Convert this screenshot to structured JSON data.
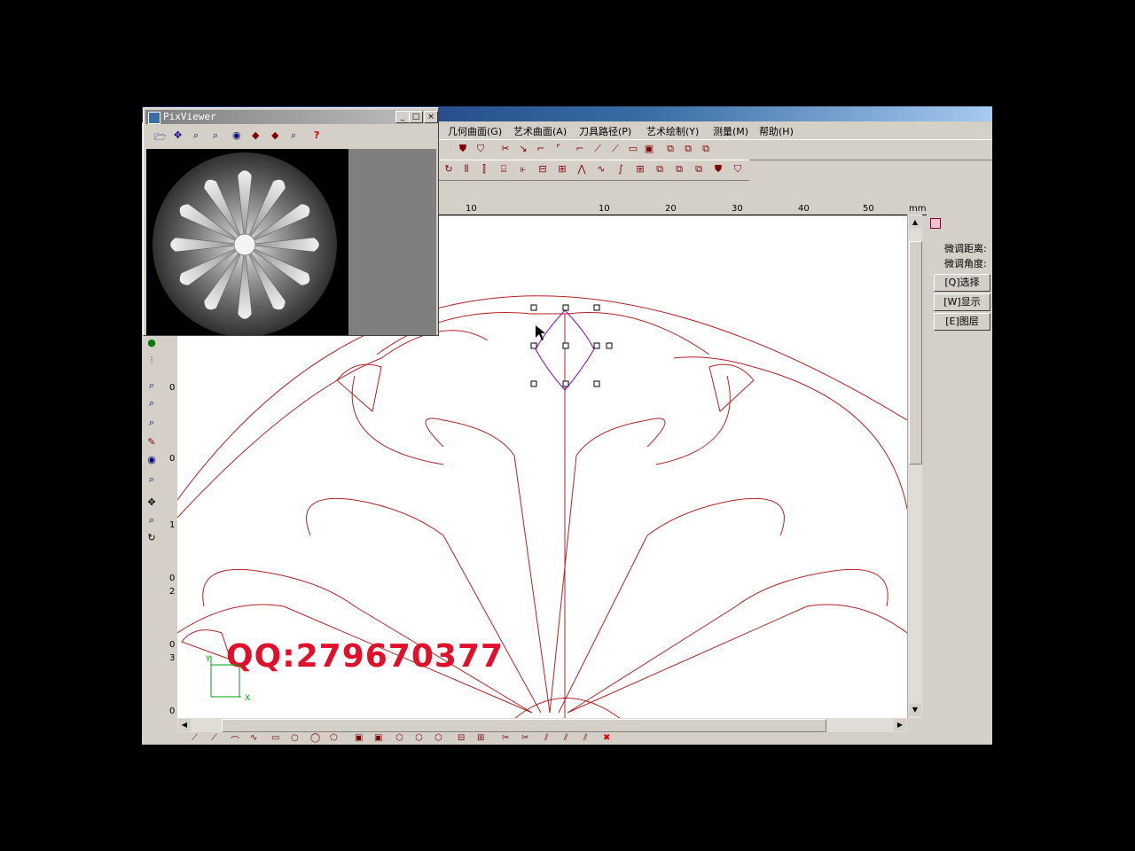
{
  "menu": [
    "几何曲面(G)",
    "艺术曲面(A)",
    "刀具路径(P)",
    "艺术绘制(Y)",
    "测量(M)",
    "帮助(H)"
  ],
  "ruler": {
    "h_labels": [
      "10",
      "10",
      "20",
      "30",
      "40",
      "50",
      "mm"
    ],
    "v_labels": [
      "0",
      "0",
      "1",
      "0",
      "2",
      "0",
      "3",
      "0"
    ]
  },
  "right_panel": {
    "label_distance": "微调距离:",
    "label_angle": "微调角度:",
    "btn_select": "[Q]选择",
    "btn_display": "[W]显示",
    "btn_layer": "[E]图层"
  },
  "pixviewer": {
    "title": "PixViewer",
    "minimize": "_",
    "maximize": "□",
    "close": "×"
  },
  "watermark": "QQ:279670377",
  "axes": {
    "x": "X",
    "y": "Y"
  },
  "colors": {
    "curve": "#b22222",
    "selection": "#8b00b0",
    "watermark": "#e0102a"
  }
}
